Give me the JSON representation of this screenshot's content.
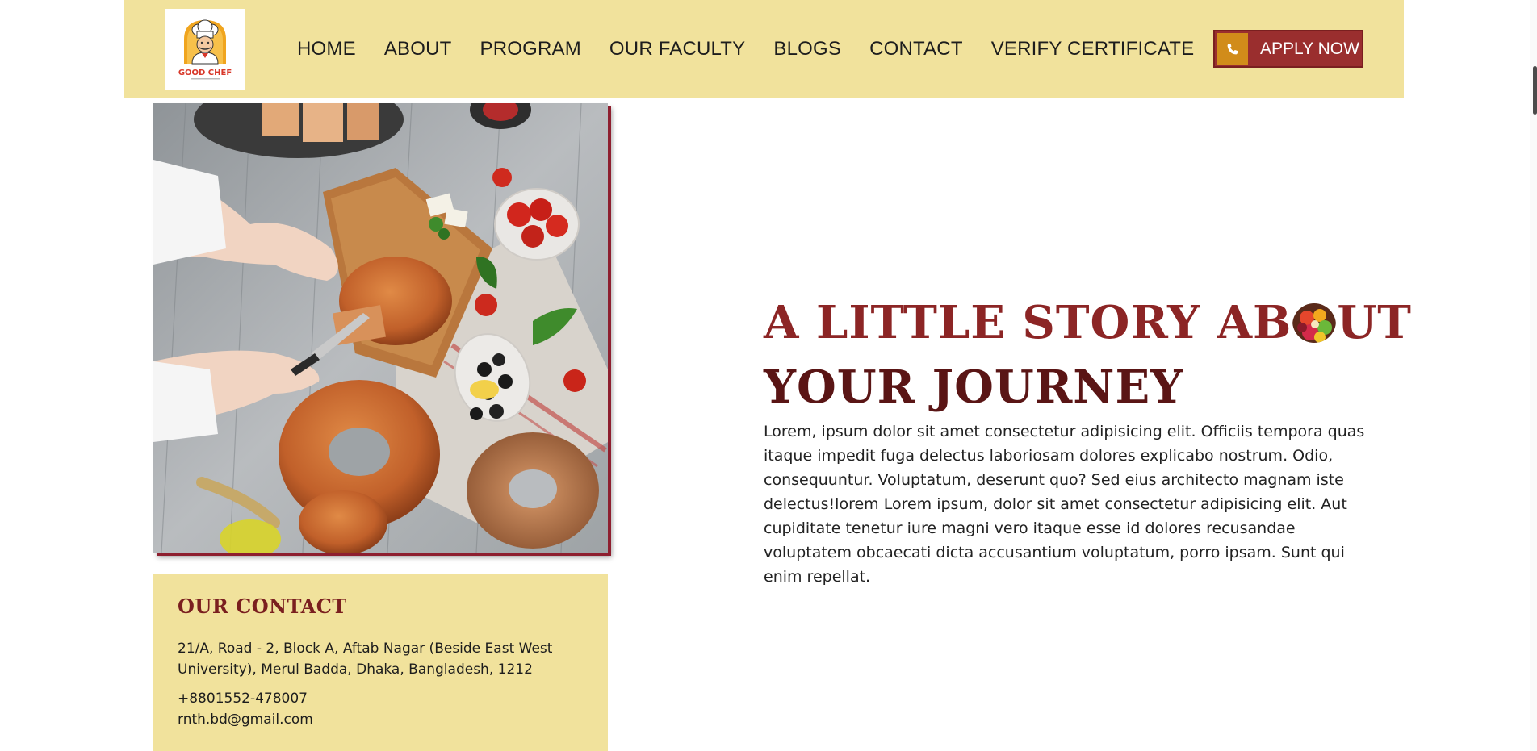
{
  "colors": {
    "header_bg": "#f1e29c",
    "accent_red": "#9a2e2e",
    "accent_orange": "#d18c1a",
    "title_red": "#8c2525",
    "title_dark": "#5a1515"
  },
  "header": {
    "logo": {
      "text": "GOOD CHEF",
      "icon": "chef-logo-icon"
    },
    "nav": [
      {
        "label": "HOME"
      },
      {
        "label": "ABOUT"
      },
      {
        "label": "PROGRAM"
      },
      {
        "label": "OUR FACULTY"
      },
      {
        "label": "BLOGS"
      },
      {
        "label": "CONTACT"
      },
      {
        "label": "VERIFY CERTIFICATE"
      }
    ],
    "apply": {
      "label": "APPLY NOW",
      "icon": "phone-icon"
    }
  },
  "story": {
    "title_part1": "A LITTLE STORY AB",
    "title_part2": "UT",
    "title_line2": "YOUR JOURNEY",
    "title_o_icon": "fruit-bowl-icon",
    "body": "Lorem, ipsum dolor sit amet consectetur adipisicing elit. Officiis tempora quas itaque impedit fuga delectus laboriosam dolores explicabo nostrum. Odio, consequuntur. Voluptatum, deserunt quo? Sed eius architecto magnam iste delectus!lorem Lorem ipsum, dolor sit amet consectetur adipisicing elit. Aut cupiditate tenetur iure magni vero itaque esse id dolores recusandae voluptatem obcaecati dicta accusantium voluptatum, porro ipsam. Sunt qui enim repellat."
  },
  "contact": {
    "title": "OUR CONTACT",
    "address": "21/A, Road - 2, Block A, Aftab Nagar (Beside East West University), Merul Badda, Dhaka, Bangladesh, 1212",
    "phone": "+8801552-478007",
    "email": "rnth.bd@gmail.com"
  },
  "hero_image": {
    "subject": "bread-cutting-photo"
  }
}
